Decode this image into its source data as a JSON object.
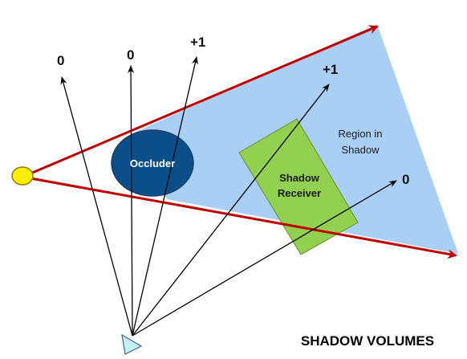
{
  "diagram": {
    "caption": "SHADOW VOLUMES",
    "occluder": {
      "label": "Occluder",
      "color": "#0b4f8a"
    },
    "receiver": {
      "line1": "Shadow",
      "line2": "Receiver",
      "color": "#92d050"
    },
    "region": {
      "line1": "Region in",
      "line2": "Shadow",
      "color": "#a9cff5"
    },
    "ray_counts": [
      "0",
      "0",
      "+1",
      "+1",
      "0"
    ],
    "light_color": "#ffee00",
    "edge_color": "#c00000"
  }
}
